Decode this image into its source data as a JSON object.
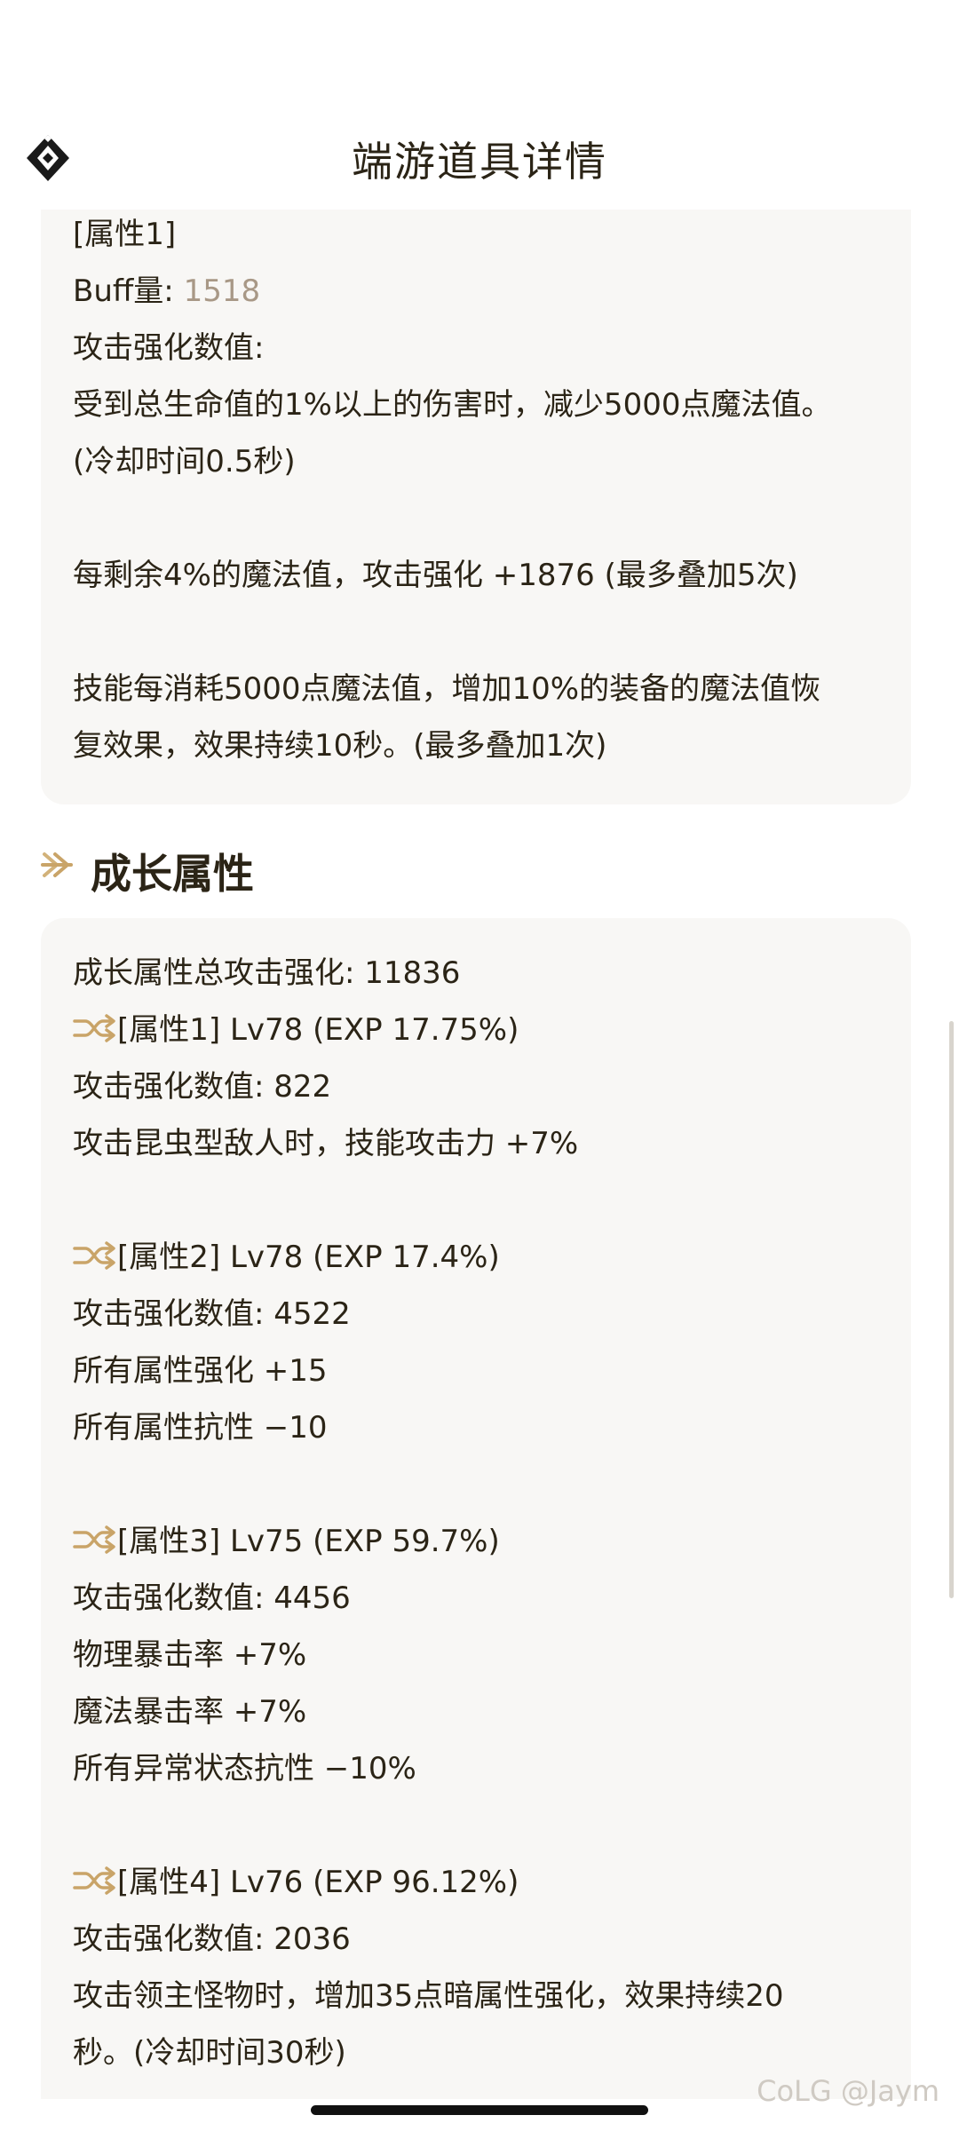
{
  "header": {
    "title": "端游道具详情"
  },
  "card1": {
    "lines": [
      "[属性1]",
      "攻击强化数值:",
      "受到总生命值的1%以上的伤害时，减少5000点魔法值。",
      "(冷却时间0.5秒)",
      "每剩余4%的魔法值，攻击强化 +1876 (最多叠加5次)",
      "技能每消耗5000点魔法值，增加10%的装备的魔法值恢",
      "复效果，效果持续10秒。(最多叠加1次)"
    ],
    "buff_label": "Buff量: ",
    "buff_value": "1518"
  },
  "growth": {
    "title": "成长属性",
    "total": "成长属性总攻击强化: 11836",
    "attrs": [
      {
        "header": "[属性1] Lv78 (EXP 17.75%)",
        "lines": [
          "攻击强化数值: 822",
          "攻击昆虫型敌人时，技能攻击力 +7%"
        ]
      },
      {
        "header": "[属性2] Lv78 (EXP 17.4%)",
        "lines": [
          "攻击强化数值: 4522",
          "所有属性强化 +15",
          "所有属性抗性 −10"
        ]
      },
      {
        "header": "[属性3] Lv75 (EXP 59.7%)",
        "lines": [
          "攻击强化数值: 4456",
          "物理暴击率 +7%",
          "魔法暴击率 +7%",
          "所有异常状态抗性 −10%"
        ]
      },
      {
        "header": "[属性4] Lv76 (EXP 96.12%)",
        "lines": [
          "攻击强化数值: 2036",
          "攻击领主怪物时，增加35点暗属性强化，效果持续20",
          "秒。(冷却时间30秒)"
        ]
      }
    ]
  },
  "watermark": "CoLG @Jaym",
  "colors": {
    "accent": "#c9a468",
    "muted": "#a89886",
    "card_bg": "#f8f7f5",
    "text": "#2b2416"
  },
  "icons": {
    "logo": "diamond-logo-icon",
    "section": "double-arrow-icon",
    "attr": "shuffle-icon"
  }
}
